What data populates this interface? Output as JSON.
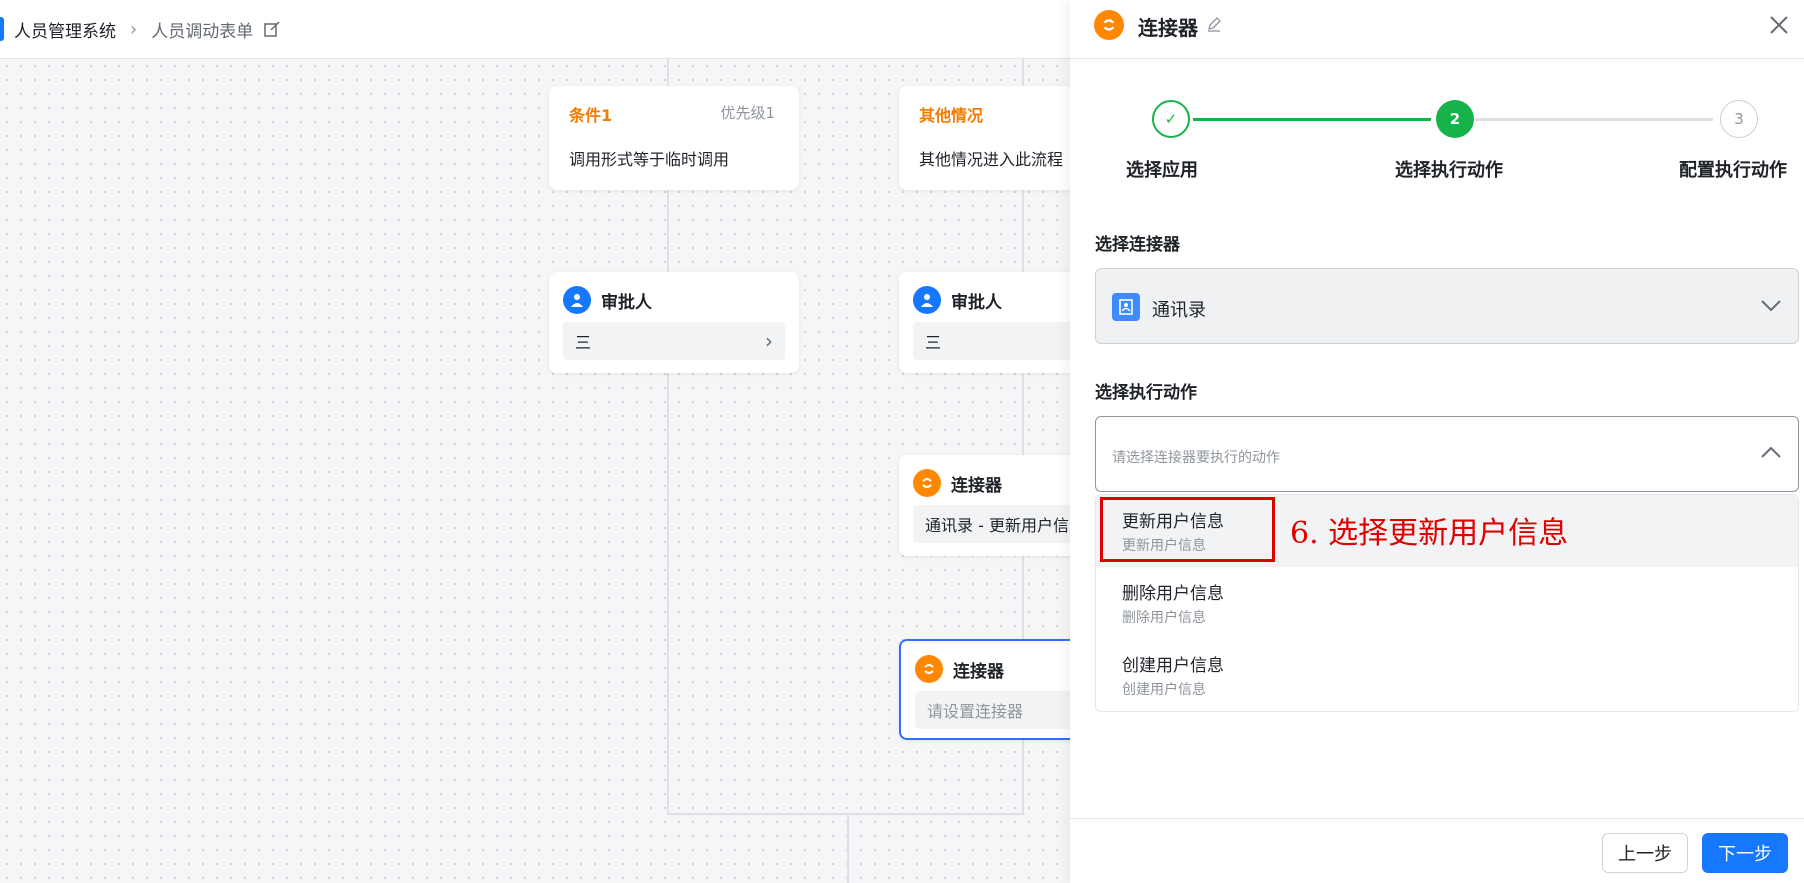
{
  "breadcrumb": {
    "root": "人员管理系统",
    "current": "人员调动表单"
  },
  "flow": {
    "condition1": {
      "title": "条件1",
      "priority": "优先级1",
      "body": "调用形式等于临时调用"
    },
    "condition_other": {
      "title": "其他情况",
      "body": "其他情况进入此流程"
    },
    "approver_left": {
      "title": "审批人",
      "value": "三"
    },
    "approver_right": {
      "title": "审批人",
      "value": "三"
    },
    "connector1": {
      "title": "连接器",
      "value": "通讯录 - 更新用户信息"
    },
    "connector2": {
      "title": "连接器",
      "placeholder": "请设置连接器"
    }
  },
  "panel": {
    "title": "连接器",
    "steps": [
      {
        "label": "选择应用",
        "mark": "✓",
        "state": "done"
      },
      {
        "label": "选择执行动作",
        "mark": "2",
        "state": "active"
      },
      {
        "label": "配置执行动作",
        "mark": "3",
        "state": "todo"
      }
    ],
    "connector_label": "选择连接器",
    "connector_value": "通讯录",
    "action_label": "选择执行动作",
    "action_placeholder": "请选择连接器要执行的动作",
    "options": [
      {
        "main": "更新用户信息",
        "sub": "更新用户信息"
      },
      {
        "main": "删除用户信息",
        "sub": "删除用户信息"
      },
      {
        "main": "创建用户信息",
        "sub": "创建用户信息"
      }
    ],
    "prev_label": "上一步",
    "next_label": "下一步"
  },
  "annotation": "6. 选择更新用户信息",
  "colors": {
    "accent": "#1677ff",
    "success": "#16b34a",
    "connector": "#ff8800",
    "condition": "#f57a00",
    "annotation": "#e00000"
  }
}
